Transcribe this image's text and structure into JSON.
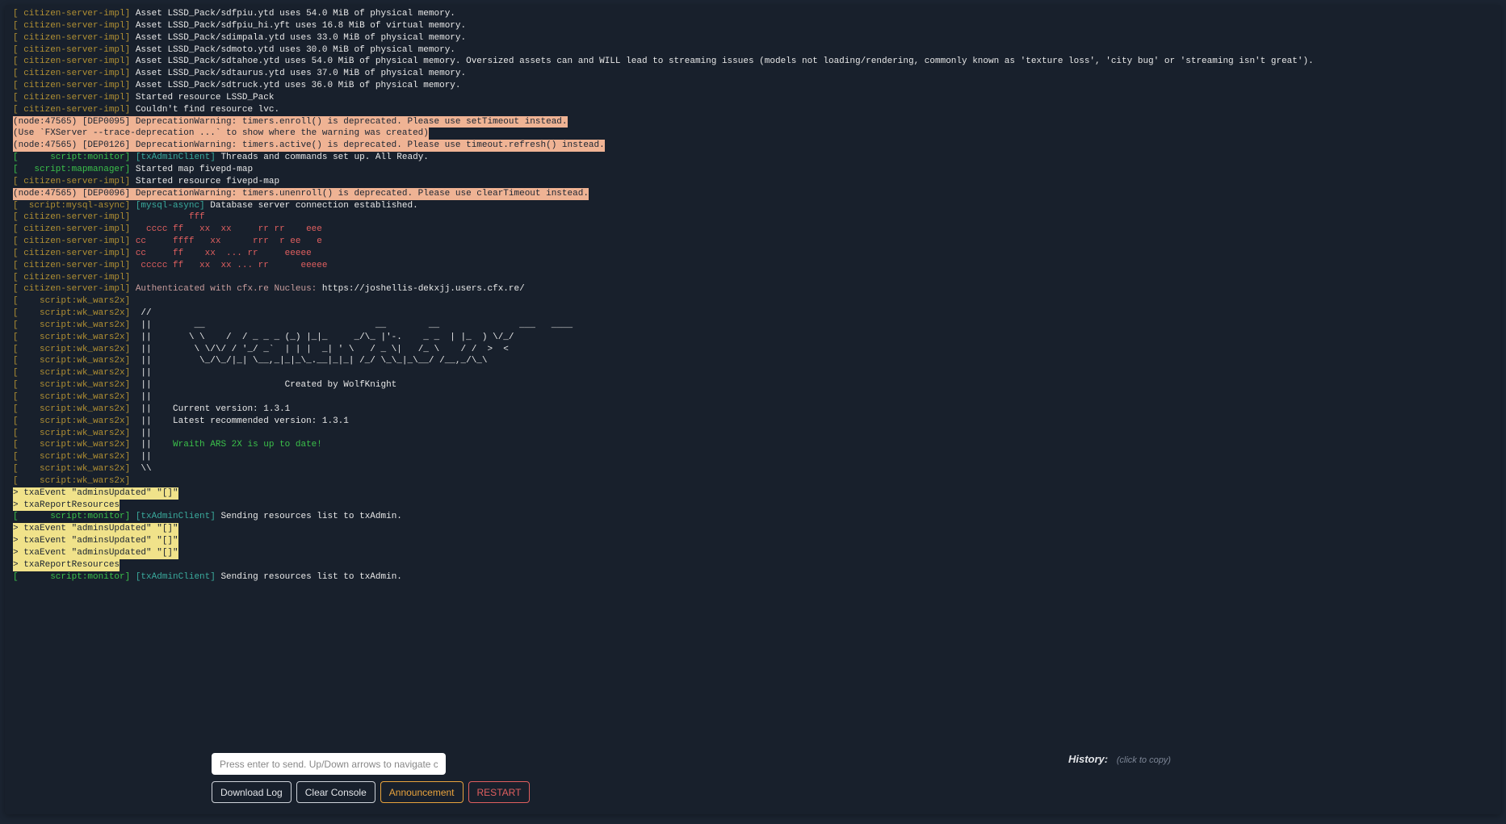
{
  "log": [
    {
      "segments": [
        {
          "t": "[ citizen-server-impl]",
          "cls": "c-olive"
        },
        {
          "t": " Asset LSSD_Pack/sdfpiu.ytd uses 54.0 MiB of physical memory.",
          "cls": "c-white"
        }
      ]
    },
    {
      "segments": [
        {
          "t": "[ citizen-server-impl]",
          "cls": "c-olive"
        },
        {
          "t": " Asset LSSD_Pack/sdfpiu_hi.yft uses 16.8 MiB of virtual memory.",
          "cls": "c-white"
        }
      ]
    },
    {
      "segments": [
        {
          "t": "[ citizen-server-impl]",
          "cls": "c-olive"
        },
        {
          "t": " Asset LSSD_Pack/sdimpala.ytd uses 33.0 MiB of physical memory.",
          "cls": "c-white"
        }
      ]
    },
    {
      "segments": [
        {
          "t": "[ citizen-server-impl]",
          "cls": "c-olive"
        },
        {
          "t": " Asset LSSD_Pack/sdmoto.ytd uses 30.0 MiB of physical memory.",
          "cls": "c-white"
        }
      ]
    },
    {
      "segments": [
        {
          "t": "[ citizen-server-impl]",
          "cls": "c-olive"
        },
        {
          "t": " Asset LSSD_Pack/sdtahoe.ytd uses 54.0 MiB of physical memory. Oversized assets can and WILL lead to streaming issues (models not loading/rendering, commonly known as 'texture loss', 'city bug' or 'streaming isn't great').",
          "cls": "c-white"
        }
      ]
    },
    {
      "segments": [
        {
          "t": "[ citizen-server-impl]",
          "cls": "c-olive"
        },
        {
          "t": " Asset LSSD_Pack/sdtaurus.ytd uses 37.0 MiB of physical memory.",
          "cls": "c-white"
        }
      ]
    },
    {
      "segments": [
        {
          "t": "[ citizen-server-impl]",
          "cls": "c-olive"
        },
        {
          "t": " Asset LSSD_Pack/sdtruck.ytd uses 36.0 MiB of physical memory.",
          "cls": "c-white"
        }
      ]
    },
    {
      "segments": [
        {
          "t": "[ citizen-server-impl]",
          "cls": "c-olive"
        },
        {
          "t": " Started resource LSSD_Pack",
          "cls": "c-white"
        }
      ]
    },
    {
      "segments": [
        {
          "t": "[ citizen-server-impl]",
          "cls": "c-olive"
        },
        {
          "t": " Couldn't find resource lvc.",
          "cls": "c-white"
        }
      ]
    },
    {
      "segments": [
        {
          "t": "(node:47565) [DEP0095] DeprecationWarning: timers.enroll() is deprecated. Please use setTimeout instead.",
          "cls": "bg-peach"
        }
      ]
    },
    {
      "segments": [
        {
          "t": "(Use `FXServer --trace-deprecation ...` to show where the warning was created)",
          "cls": "bg-peach"
        }
      ]
    },
    {
      "segments": [
        {
          "t": "(node:47565) [DEP0126] DeprecationWarning: timers.active() is deprecated. Please use timeout.refresh() instead.",
          "cls": "bg-peach"
        }
      ]
    },
    {
      "segments": [
        {
          "t": "[      script:monitor]",
          "cls": "c-green"
        },
        {
          "t": " [txAdminClient]",
          "cls": "c-teal"
        },
        {
          "t": " Threads and commands set up. All Ready.",
          "cls": "c-white"
        }
      ]
    },
    {
      "segments": [
        {
          "t": "[   script:mapmanager]",
          "cls": "c-green"
        },
        {
          "t": " Started map fivepd-map",
          "cls": "c-white"
        }
      ]
    },
    {
      "segments": [
        {
          "t": "[ citizen-server-impl]",
          "cls": "c-olive"
        },
        {
          "t": " Started resource fivepd-map",
          "cls": "c-white"
        }
      ]
    },
    {
      "segments": [
        {
          "t": "(node:47565) [DEP0096] DeprecationWarning: timers.unenroll() is deprecated. Please use clearTimeout instead.",
          "cls": "bg-peach"
        }
      ]
    },
    {
      "segments": [
        {
          "t": "[  script:mysql-async]",
          "cls": "c-olive"
        },
        {
          "t": " [mysql-async]",
          "cls": "c-teal"
        },
        {
          "t": " Database server connection established.",
          "cls": "c-white"
        }
      ]
    },
    {
      "segments": [
        {
          "t": "[ citizen-server-impl]",
          "cls": "c-olive"
        },
        {
          "t": "           fff",
          "cls": "c-red"
        }
      ]
    },
    {
      "segments": [
        {
          "t": "[ citizen-server-impl]",
          "cls": "c-olive"
        },
        {
          "t": "   cccc ff   xx  xx     rr rr    eee",
          "cls": "c-red"
        }
      ]
    },
    {
      "segments": [
        {
          "t": "[ citizen-server-impl]",
          "cls": "c-olive"
        },
        {
          "t": " cc     ffff   xx      rrr  r ee   e",
          "cls": "c-red"
        }
      ]
    },
    {
      "segments": [
        {
          "t": "[ citizen-server-impl]",
          "cls": "c-olive"
        },
        {
          "t": " cc     ff    xx  ... rr     eeeee",
          "cls": "c-red"
        }
      ]
    },
    {
      "segments": [
        {
          "t": "[ citizen-server-impl]",
          "cls": "c-olive"
        },
        {
          "t": "  ccccc ff   xx  xx ... rr      eeeee",
          "cls": "c-red"
        }
      ]
    },
    {
      "segments": [
        {
          "t": "[ citizen-server-impl]",
          "cls": "c-olive"
        }
      ]
    },
    {
      "segments": [
        {
          "t": "[ citizen-server-impl]",
          "cls": "c-olive"
        },
        {
          "t": " Authenticated with cfx.re Nucleus: ",
          "cls": "c-mauve"
        },
        {
          "t": "https://joshellis-dekxjj.users.cfx.re/",
          "cls": "c-white"
        }
      ]
    },
    {
      "segments": [
        {
          "t": "[    script:wk_wars2x]",
          "cls": "c-olive"
        }
      ]
    },
    {
      "segments": [
        {
          "t": "[    script:wk_wars2x]",
          "cls": "c-olive"
        },
        {
          "t": "  //",
          "cls": "c-white"
        }
      ]
    },
    {
      "segments": [
        {
          "t": "[    script:wk_wars2x]",
          "cls": "c-olive"
        },
        {
          "t": "  ||        __                                __        __               ___   ____",
          "cls": "c-white"
        }
      ]
    },
    {
      "segments": [
        {
          "t": "[    script:wk_wars2x]",
          "cls": "c-olive"
        },
        {
          "t": "  ||       \\ \\    /  / _ _ _ (_) |_|_     _/\\_ |'-.    _ _  | |_  ) \\/_/",
          "cls": "c-white"
        }
      ]
    },
    {
      "segments": [
        {
          "t": "[    script:wk_wars2x]",
          "cls": "c-olive"
        },
        {
          "t": "  ||        \\ \\/\\/ / '_/ _`  | | |  _| ' \\   / _ \\|   /_ \\    / /  >  <",
          "cls": "c-white"
        }
      ]
    },
    {
      "segments": [
        {
          "t": "[    script:wk_wars2x]",
          "cls": "c-olive"
        },
        {
          "t": "  ||         \\_/\\_/|_| \\__,_|_|_\\_.__|_|_| /_/ \\_\\_|_\\__/ /__,_/\\_\\",
          "cls": "c-white"
        }
      ]
    },
    {
      "segments": [
        {
          "t": "[    script:wk_wars2x]",
          "cls": "c-olive"
        },
        {
          "t": "  ||",
          "cls": "c-white"
        }
      ]
    },
    {
      "segments": [
        {
          "t": "[    script:wk_wars2x]",
          "cls": "c-olive"
        },
        {
          "t": "  ||                         Created by WolfKnight",
          "cls": "c-white"
        }
      ]
    },
    {
      "segments": [
        {
          "t": "[    script:wk_wars2x]",
          "cls": "c-olive"
        },
        {
          "t": "  ||",
          "cls": "c-white"
        }
      ]
    },
    {
      "segments": [
        {
          "t": "[    script:wk_wars2x]",
          "cls": "c-olive"
        },
        {
          "t": "  ||    Current version: 1.3.1",
          "cls": "c-white"
        }
      ]
    },
    {
      "segments": [
        {
          "t": "[    script:wk_wars2x]",
          "cls": "c-olive"
        },
        {
          "t": "  ||    Latest recommended version: 1.3.1",
          "cls": "c-white"
        }
      ]
    },
    {
      "segments": [
        {
          "t": "[    script:wk_wars2x]",
          "cls": "c-olive"
        },
        {
          "t": "  ||",
          "cls": "c-white"
        }
      ]
    },
    {
      "segments": [
        {
          "t": "[    script:wk_wars2x]",
          "cls": "c-olive"
        },
        {
          "t": "  ||    ",
          "cls": "c-white"
        },
        {
          "t": "Wraith ARS 2X is up to date!",
          "cls": "c-green"
        }
      ]
    },
    {
      "segments": [
        {
          "t": "[    script:wk_wars2x]",
          "cls": "c-olive"
        },
        {
          "t": "  ||",
          "cls": "c-white"
        }
      ]
    },
    {
      "segments": [
        {
          "t": "[    script:wk_wars2x]",
          "cls": "c-olive"
        },
        {
          "t": "  \\\\",
          "cls": "c-white"
        }
      ]
    },
    {
      "segments": [
        {
          "t": "[    script:wk_wars2x]",
          "cls": "c-olive"
        }
      ]
    },
    {
      "segments": [
        {
          "t": "> txaEvent \"adminsUpdated\" \"[]\"",
          "cls": "bg-yellow"
        }
      ]
    },
    {
      "segments": [
        {
          "t": "> txaReportResources",
          "cls": "bg-yellow"
        }
      ]
    },
    {
      "segments": [
        {
          "t": "[      script:monitor]",
          "cls": "c-green"
        },
        {
          "t": " [txAdminClient]",
          "cls": "c-teal"
        },
        {
          "t": " Sending resources list to txAdmin.",
          "cls": "c-white"
        }
      ]
    },
    {
      "segments": [
        {
          "t": "> txaEvent \"adminsUpdated\" \"[]\"",
          "cls": "bg-yellow"
        }
      ]
    },
    {
      "segments": [
        {
          "t": "> txaEvent \"adminsUpdated\" \"[]\"",
          "cls": "bg-yellow"
        }
      ]
    },
    {
      "segments": [
        {
          "t": "> txaEvent \"adminsUpdated\" \"[]\"",
          "cls": "bg-yellow"
        }
      ]
    },
    {
      "segments": [
        {
          "t": "> txaReportResources",
          "cls": "bg-yellow"
        }
      ]
    },
    {
      "segments": [
        {
          "t": "[      script:monitor]",
          "cls": "c-green"
        },
        {
          "t": " [txAdminClient]",
          "cls": "c-teal"
        },
        {
          "t": " Sending resources list to txAdmin.",
          "cls": "c-white"
        }
      ]
    }
  ],
  "toolbar": {
    "input_placeholder": "Press enter to send. Up/Down arrows to navigate commands.",
    "download_label": "Download Log",
    "clear_label": "Clear Console",
    "announce_label": "Announcement",
    "restart_label": "RESTART"
  },
  "history": {
    "title": "History:",
    "hint": "(click to copy)"
  }
}
